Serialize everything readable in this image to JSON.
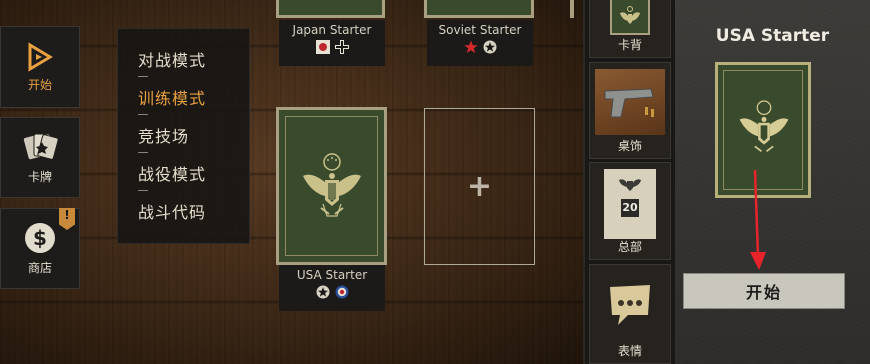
{
  "nav": {
    "start_label": "开始",
    "cards_label": "卡牌",
    "shop_label": "商店",
    "shop_badge": "!"
  },
  "mode_menu": {
    "items": [
      "对战模式",
      "训练模式",
      "竞技场",
      "战役模式",
      "战斗代码"
    ],
    "active_index": 1
  },
  "decks": {
    "japan_name": "Japan Starter",
    "soviet_name": "Soviet Starter",
    "usa_name": "USA Starter",
    "empty_slot_symbol": "+"
  },
  "right_column": {
    "items": [
      "卡背",
      "桌饰",
      "总部",
      "表情"
    ],
    "hq_value": "20"
  },
  "selected_panel": {
    "title": "USA Starter",
    "start_label": "开始"
  },
  "colors": {
    "accent": "#e8a040",
    "card_green": "#3a4a2c",
    "arrow_red": "#e8232a"
  }
}
